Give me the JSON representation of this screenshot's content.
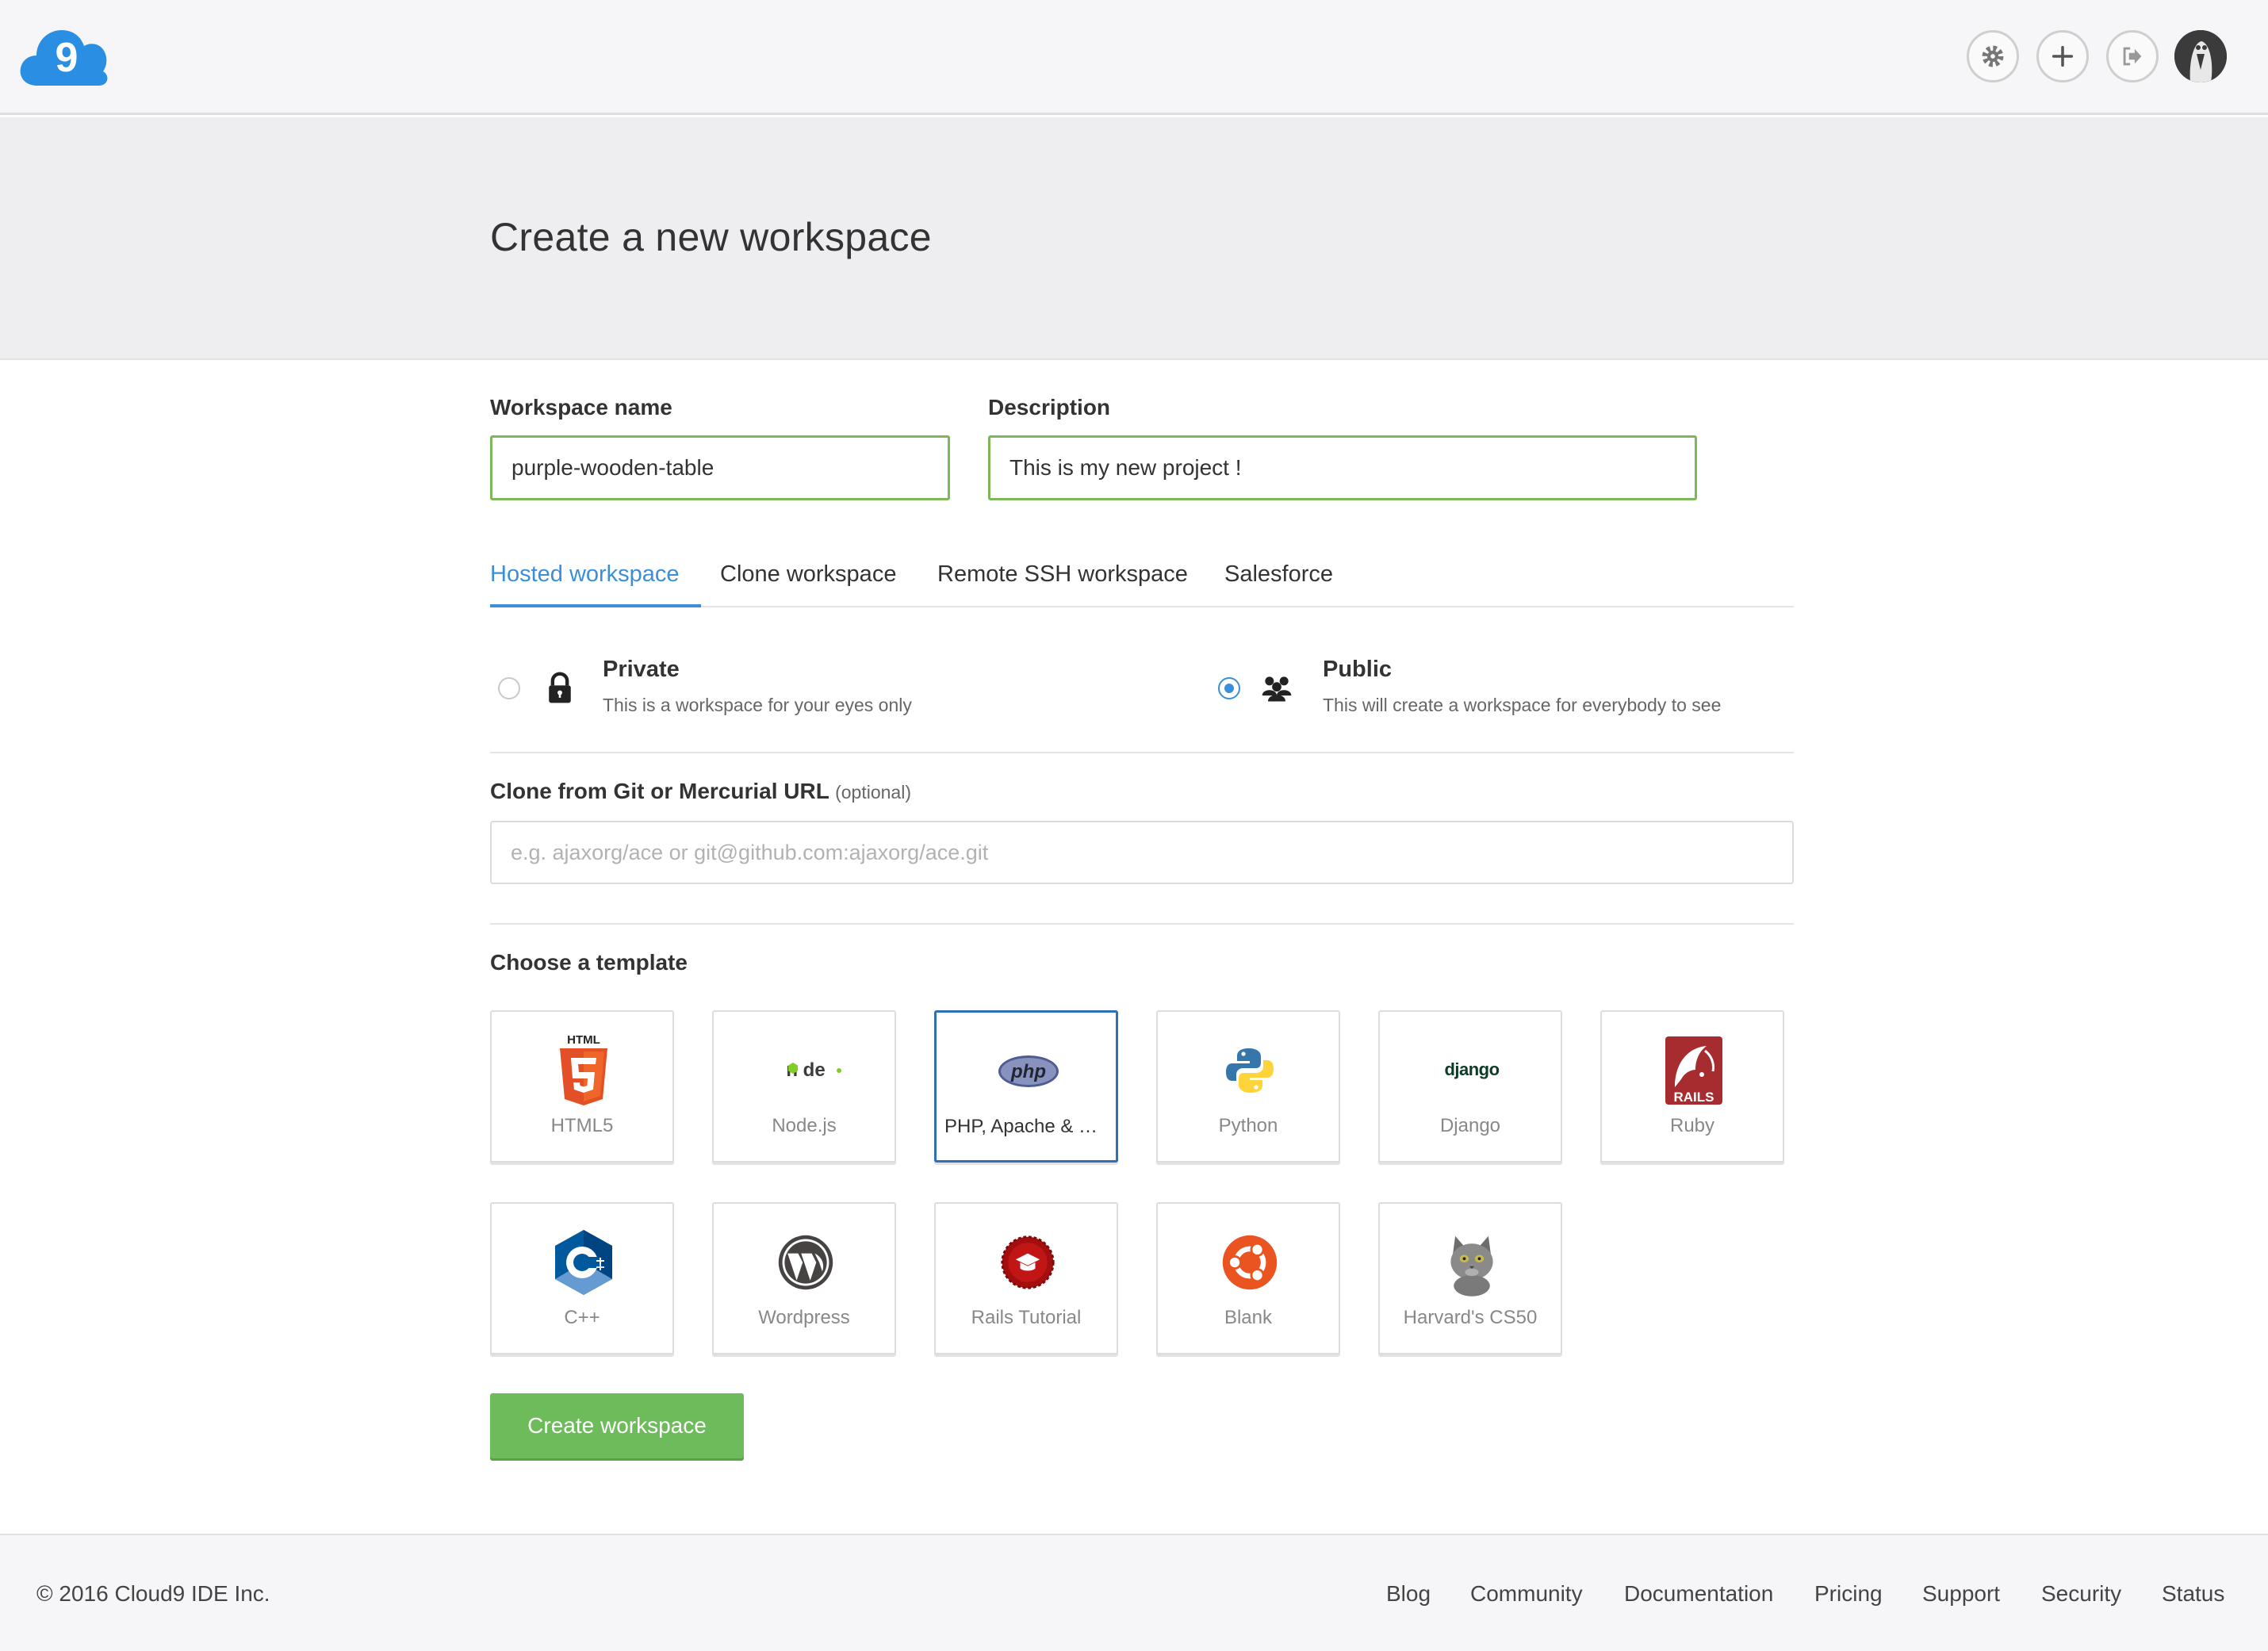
{
  "header": {
    "logo_text": "9",
    "settings_icon": "gear-icon",
    "add_icon": "plus-icon",
    "logout_icon": "sign-out-icon"
  },
  "page_title": "Create a new workspace",
  "form": {
    "name_label": "Workspace name",
    "name_value": "purple-wooden-table",
    "description_label": "Description",
    "description_value": "This is my new project !"
  },
  "tabs": [
    {
      "label": "Hosted workspace",
      "active": true
    },
    {
      "label": "Clone workspace",
      "active": false
    },
    {
      "label": "Remote SSH workspace",
      "active": false
    },
    {
      "label": "Salesforce",
      "active": false
    }
  ],
  "visibility": {
    "private": {
      "title": "Private",
      "desc": "This is a workspace for your eyes only",
      "selected": false
    },
    "public": {
      "title": "Public",
      "desc": "This will create a workspace for everybody to see",
      "selected": true
    }
  },
  "clone": {
    "label": "Clone from Git or Mercurial URL",
    "optional": "(optional)",
    "placeholder": "e.g. ajaxorg/ace or git@github.com:ajaxorg/ace.git"
  },
  "templates_label": "Choose a template",
  "templates": [
    {
      "name": "HTML5",
      "icon": "html5-icon"
    },
    {
      "name": "Node.js",
      "icon": "nodejs-icon"
    },
    {
      "name": "PHP, Apache & MySQL",
      "icon": "php-icon",
      "selected": true
    },
    {
      "name": "Python",
      "icon": "python-icon"
    },
    {
      "name": "Django",
      "icon": "django-icon"
    },
    {
      "name": "Ruby",
      "icon": "rails-icon"
    },
    {
      "name": "C++",
      "icon": "cpp-icon"
    },
    {
      "name": "Wordpress",
      "icon": "wordpress-icon"
    },
    {
      "name": "Rails Tutorial",
      "icon": "rails-tutorial-icon"
    },
    {
      "name": "Blank",
      "icon": "ubuntu-icon"
    },
    {
      "name": "Harvard's CS50",
      "icon": "cat-icon"
    }
  ],
  "create_button": "Create workspace",
  "footer": {
    "copyright": "© 2016 Cloud9 IDE Inc.",
    "links": [
      "Blog",
      "Community",
      "Documentation",
      "Pricing",
      "Support",
      "Security",
      "Status"
    ]
  },
  "colors": {
    "accent": "#3b8fd9",
    "success": "#6dbb5b",
    "valid_border": "#7cb85a"
  }
}
